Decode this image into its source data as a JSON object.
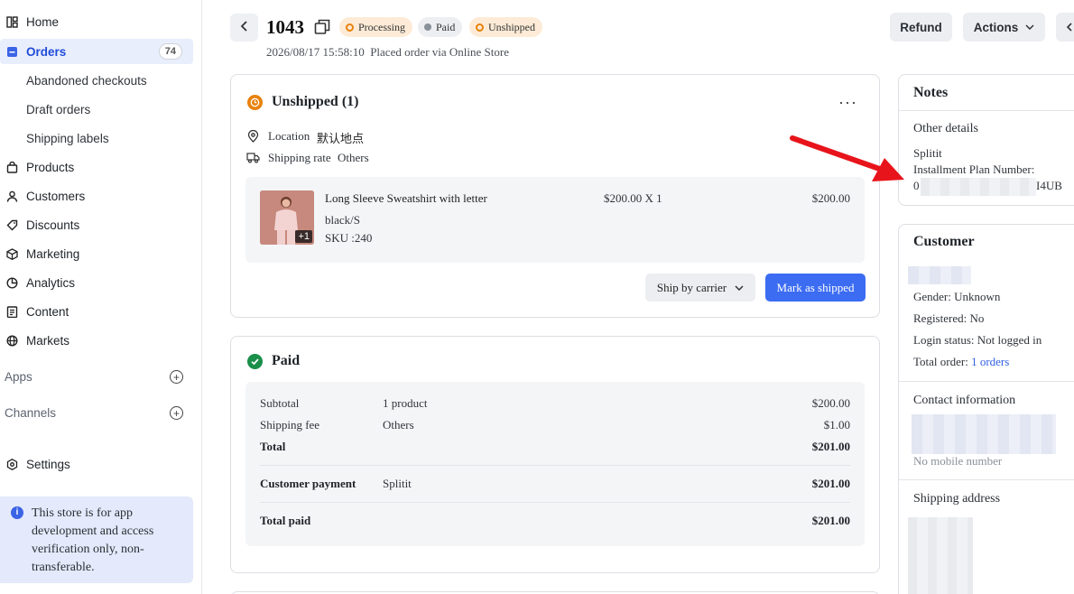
{
  "sidebar": {
    "home": "Home",
    "orders": "Orders",
    "orders_count": "74",
    "abandoned": "Abandoned checkouts",
    "drafts": "Draft orders",
    "shipping_labels": "Shipping labels",
    "products": "Products",
    "customers": "Customers",
    "discounts": "Discounts",
    "marketing": "Marketing",
    "analytics": "Analytics",
    "content": "Content",
    "markets": "Markets",
    "apps": "Apps",
    "channels": "Channels",
    "settings": "Settings",
    "notice": "This store is for app development and access verification only, non-transferable."
  },
  "header": {
    "order_number": "1043",
    "badges": [
      "Processing",
      "Paid",
      "Unshipped"
    ],
    "subtitle": "2026/08/17 15:58:10  Placed order via Online Store",
    "refund": "Refund",
    "actions": "Actions"
  },
  "unshipped": {
    "title": "Unshipped (1)",
    "location_label": "Location",
    "location_value": "默认地点",
    "rate_label": "Shipping rate",
    "rate_value": "Others",
    "item": {
      "name": "Long Sleeve Sweatshirt with letter",
      "variant": "black/S",
      "sku": "SKU :240",
      "price_qty": "$200.00 X 1",
      "total": "$200.00",
      "extra": "+1"
    },
    "ship_by": "Ship by carrier",
    "mark_shipped": "Mark as shipped"
  },
  "paid": {
    "title": "Paid",
    "subtotal_label": "Subtotal",
    "subtotal_desc": "1 product",
    "subtotal_value": "$200.00",
    "shipping_label": "Shipping fee",
    "shipping_desc": "Others",
    "shipping_value": "$1.00",
    "total_label": "Total",
    "total_value": "$201.00",
    "payment_label": "Customer payment",
    "payment_desc": "Splitit",
    "payment_value": "$201.00",
    "paid_label": "Total paid",
    "paid_value": "$201.00"
  },
  "notes": {
    "title": "Notes",
    "other": "Other details",
    "provider": "Splitit",
    "plan_label": "Installment Plan Number:",
    "plan_start": "0",
    "plan_end": "I4UB"
  },
  "customer": {
    "title": "Customer",
    "gender": "Gender: Unknown",
    "registered": "Registered: No",
    "login": "Login status: Not logged in",
    "total_order_label": "Total order: ",
    "total_order_link": "1 orders",
    "contact_title": "Contact information",
    "no_mobile": "No mobile number",
    "shipping_title": "Shipping address"
  },
  "colors": {
    "accent": "#3b6cf2",
    "processing": "#e8820c",
    "paid_green": "#1a8f4a",
    "arrow": "#e8141b"
  }
}
